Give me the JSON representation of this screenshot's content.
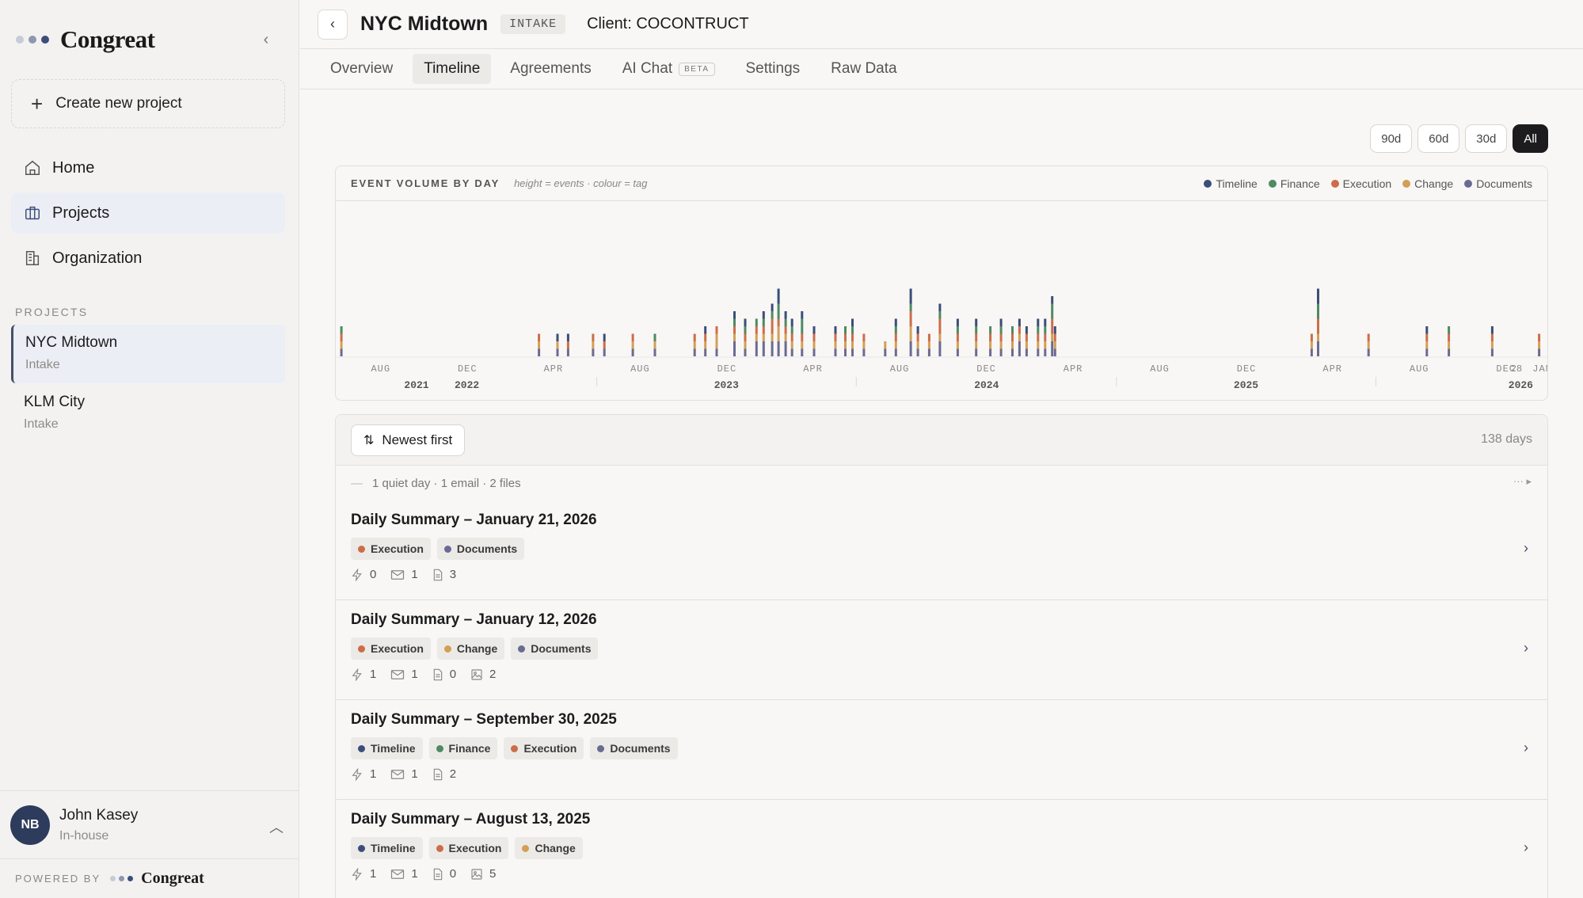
{
  "colors": {
    "timeline": "#3b4e7a",
    "finance": "#4e8a63",
    "execution": "#cc6d4a",
    "change": "#d39e55",
    "documents": "#6a6b93"
  },
  "sidebar": {
    "logo_text": "Congreat",
    "new_project_label": "Create new project",
    "nav": [
      {
        "label": "Home",
        "icon": "home-icon"
      },
      {
        "label": "Projects",
        "icon": "briefcase-icon"
      },
      {
        "label": "Organization",
        "icon": "building-icon"
      }
    ],
    "projects_label": "PROJECTS",
    "projects": [
      {
        "name": "NYC Midtown",
        "status": "Intake"
      },
      {
        "name": "KLM City",
        "status": "Intake"
      }
    ],
    "user": {
      "initials": "NB",
      "name": "John Kasey",
      "role": "In-house"
    },
    "powered_by": "POWERED BY",
    "powered_logo": "Congreat"
  },
  "header": {
    "title": "NYC Midtown",
    "badge": "INTAKE",
    "client": "Client: COCONTRUCT"
  },
  "tabs": [
    {
      "label": "Overview"
    },
    {
      "label": "Timeline"
    },
    {
      "label": "Agreements"
    },
    {
      "label": "AI Chat",
      "badge": "BETA"
    },
    {
      "label": "Settings"
    },
    {
      "label": "Raw Data"
    }
  ],
  "range_buttons": [
    "90d",
    "60d",
    "30d",
    "All"
  ],
  "chart": {
    "title": "EVENT VOLUME BY DAY",
    "subtitle": "height = events · colour = tag",
    "legend": [
      "Timeline",
      "Finance",
      "Execution",
      "Change",
      "Documents"
    ]
  },
  "chart_data": {
    "type": "bar",
    "title": "EVENT VOLUME BY DAY",
    "stacked": true,
    "x_ticks_months": [
      "AUG",
      "DEC",
      "APR",
      "AUG",
      "DEC",
      "APR",
      "AUG",
      "DEC",
      "APR",
      "AUG",
      "DEC",
      "APR",
      "AUG",
      "DEC",
      "JAN"
    ],
    "x_ticks_years": [
      "2021",
      "2022",
      "2023",
      "2024",
      "2025",
      "2026"
    ],
    "extra_tick": "28",
    "series_names": [
      "Timeline",
      "Finance",
      "Execution",
      "Change",
      "Documents"
    ],
    "bars": [
      {
        "date": "2021-06-05",
        "values": [
          0,
          1,
          1,
          1,
          1
        ]
      },
      {
        "date": "2022-03-10",
        "values": [
          0,
          0,
          1,
          1,
          1
        ]
      },
      {
        "date": "2022-04-05",
        "values": [
          1,
          0,
          0,
          1,
          1
        ]
      },
      {
        "date": "2022-04-20",
        "values": [
          1,
          0,
          1,
          0,
          1
        ]
      },
      {
        "date": "2022-05-25",
        "values": [
          0,
          0,
          1,
          1,
          1
        ]
      },
      {
        "date": "2022-06-10",
        "values": [
          1,
          0,
          1,
          0,
          1
        ]
      },
      {
        "date": "2022-07-20",
        "values": [
          0,
          0,
          1,
          1,
          1
        ]
      },
      {
        "date": "2022-08-20",
        "values": [
          0,
          1,
          0,
          1,
          1
        ]
      },
      {
        "date": "2022-10-15",
        "values": [
          0,
          0,
          1,
          1,
          1
        ]
      },
      {
        "date": "2022-10-30",
        "values": [
          1,
          0,
          1,
          1,
          1
        ]
      },
      {
        "date": "2022-11-15",
        "values": [
          0,
          0,
          1,
          2,
          1
        ]
      },
      {
        "date": "2022-12-10",
        "values": [
          1,
          1,
          1,
          1,
          2
        ]
      },
      {
        "date": "2022-12-25",
        "values": [
          1,
          1,
          1,
          1,
          1
        ]
      },
      {
        "date": "2023-01-10",
        "values": [
          0,
          1,
          1,
          1,
          2
        ]
      },
      {
        "date": "2023-01-20",
        "values": [
          1,
          1,
          1,
          1,
          2
        ]
      },
      {
        "date": "2023-02-01",
        "values": [
          1,
          1,
          2,
          1,
          2
        ]
      },
      {
        "date": "2023-02-10",
        "values": [
          2,
          2,
          1,
          2,
          2
        ]
      },
      {
        "date": "2023-02-20",
        "values": [
          1,
          1,
          1,
          1,
          2
        ]
      },
      {
        "date": "2023-03-01",
        "values": [
          1,
          1,
          1,
          1,
          1
        ]
      },
      {
        "date": "2023-03-15",
        "values": [
          1,
          2,
          1,
          1,
          1
        ]
      },
      {
        "date": "2023-04-01",
        "values": [
          1,
          0,
          1,
          1,
          1
        ]
      },
      {
        "date": "2023-05-01",
        "values": [
          1,
          0,
          1,
          1,
          1
        ]
      },
      {
        "date": "2023-05-15",
        "values": [
          0,
          1,
          1,
          1,
          1
        ]
      },
      {
        "date": "2023-05-25",
        "values": [
          1,
          1,
          1,
          1,
          1
        ]
      },
      {
        "date": "2023-06-10",
        "values": [
          0,
          0,
          1,
          1,
          1
        ]
      },
      {
        "date": "2023-07-10",
        "values": [
          0,
          0,
          0,
          1,
          1
        ]
      },
      {
        "date": "2023-07-25",
        "values": [
          1,
          1,
          1,
          1,
          1
        ]
      },
      {
        "date": "2023-08-15",
        "values": [
          2,
          1,
          2,
          2,
          2
        ]
      },
      {
        "date": "2023-08-25",
        "values": [
          1,
          0,
          1,
          1,
          1
        ]
      },
      {
        "date": "2023-09-10",
        "values": [
          0,
          0,
          1,
          1,
          1
        ]
      },
      {
        "date": "2023-09-25",
        "values": [
          1,
          1,
          2,
          1,
          2
        ]
      },
      {
        "date": "2023-10-20",
        "values": [
          1,
          1,
          1,
          1,
          1
        ]
      },
      {
        "date": "2023-11-15",
        "values": [
          1,
          1,
          1,
          1,
          1
        ]
      },
      {
        "date": "2023-12-05",
        "values": [
          0,
          1,
          1,
          1,
          1
        ]
      },
      {
        "date": "2023-12-20",
        "values": [
          1,
          1,
          1,
          1,
          1
        ]
      },
      {
        "date": "2024-01-05",
        "values": [
          0,
          1,
          1,
          1,
          1
        ]
      },
      {
        "date": "2024-01-15",
        "values": [
          1,
          0,
          1,
          1,
          2
        ]
      },
      {
        "date": "2024-01-25",
        "values": [
          1,
          0,
          1,
          1,
          1
        ]
      },
      {
        "date": "2024-02-10",
        "values": [
          1,
          1,
          1,
          1,
          1
        ]
      },
      {
        "date": "2024-02-20",
        "values": [
          1,
          1,
          1,
          1,
          1
        ]
      },
      {
        "date": "2024-03-01",
        "values": [
          1,
          2,
          2,
          1,
          2
        ]
      },
      {
        "date": "2024-03-05",
        "values": [
          1,
          0,
          1,
          1,
          1
        ]
      },
      {
        "date": "2025-03-01",
        "values": [
          0,
          0,
          1,
          1,
          1
        ]
      },
      {
        "date": "2025-03-10",
        "values": [
          2,
          2,
          2,
          1,
          2
        ]
      },
      {
        "date": "2025-05-20",
        "values": [
          0,
          0,
          1,
          1,
          1
        ]
      },
      {
        "date": "2025-08-10",
        "values": [
          1,
          0,
          1,
          1,
          1
        ]
      },
      {
        "date": "2025-09-10",
        "values": [
          0,
          1,
          1,
          1,
          1
        ]
      },
      {
        "date": "2025-11-10",
        "values": [
          1,
          0,
          1,
          1,
          1
        ]
      },
      {
        "date": "2026-01-15",
        "values": [
          0,
          0,
          1,
          1,
          1
        ]
      }
    ]
  },
  "feed": {
    "sort_label": "Newest first",
    "days_label": "138 days",
    "quiet_label": "1 quiet day · 1 email · 2 files",
    "summaries": [
      {
        "title": "Daily Summary – January 21, 2026",
        "tags": [
          "Execution",
          "Documents"
        ],
        "stats": {
          "events": "0",
          "emails": "1",
          "files": "3"
        }
      },
      {
        "title": "Daily Summary – January 12, 2026",
        "tags": [
          "Execution",
          "Change",
          "Documents"
        ],
        "stats": {
          "events": "1",
          "emails": "1",
          "files": "0",
          "images": "2"
        }
      },
      {
        "title": "Daily Summary – September 30, 2025",
        "tags": [
          "Timeline",
          "Finance",
          "Execution",
          "Documents"
        ],
        "stats": {
          "events": "1",
          "emails": "1",
          "files": "2"
        }
      },
      {
        "title": "Daily Summary – August 13, 2025",
        "tags": [
          "Timeline",
          "Execution",
          "Change"
        ],
        "stats": {
          "events": "1",
          "emails": "1",
          "files": "0",
          "images": "5"
        }
      }
    ]
  }
}
